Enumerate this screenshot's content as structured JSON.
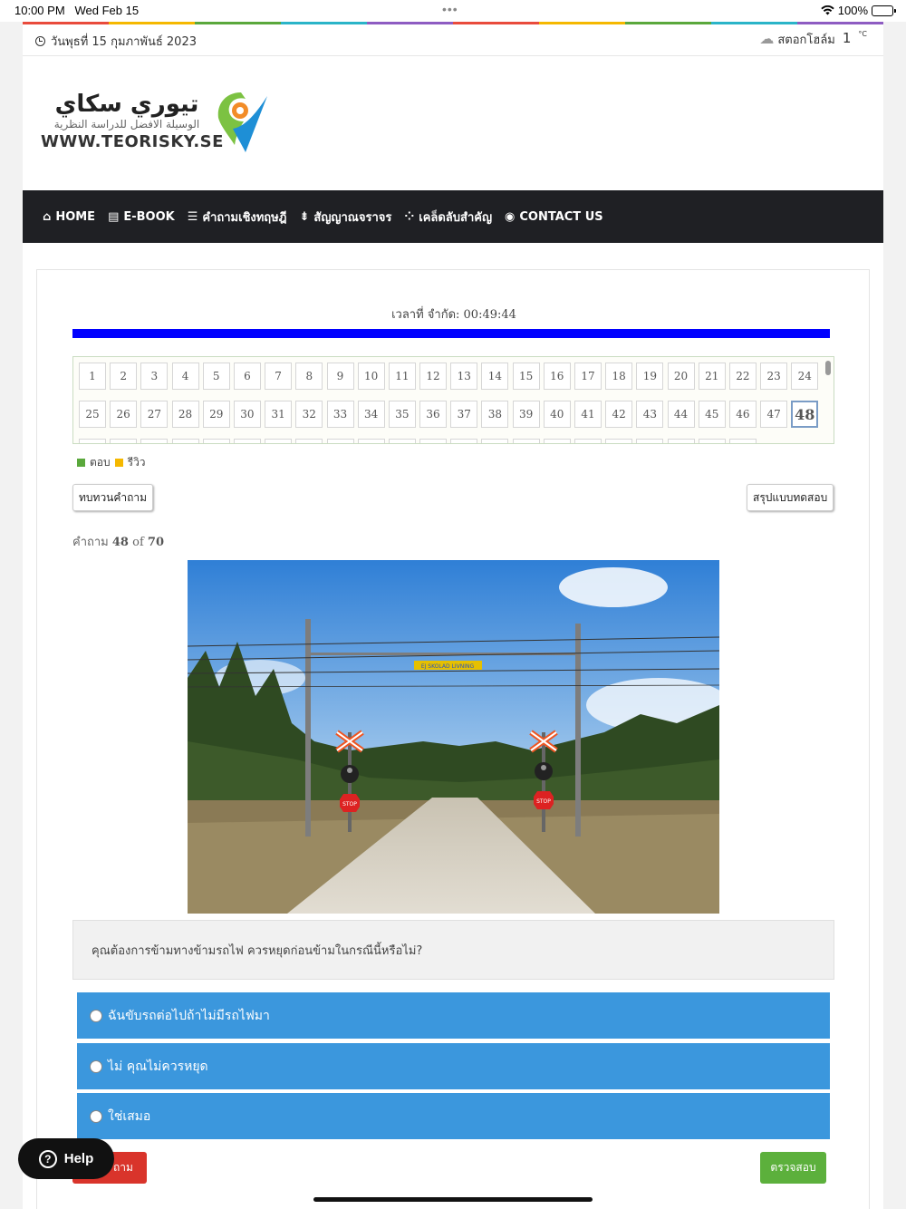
{
  "status_bar": {
    "time": "10:00 PM",
    "date": "Wed Feb 15",
    "battery": "100%"
  },
  "topbar": {
    "date": "วันพุธที่ 15 กุมภาพันธ์ 2023",
    "city": "สตอกโฮล์ม",
    "temp": "1",
    "unit": "°C"
  },
  "logo": {
    "arabic_title": "تيوري سكاي",
    "arabic_subtitle": "الوسيلة الافضل للدراسة النظرية",
    "url": "WWW.TEORISKY.SE"
  },
  "nav": {
    "items": [
      {
        "label": "HOME",
        "icon": "home-icon"
      },
      {
        "label": "E-BOOK",
        "icon": "book-icon"
      },
      {
        "label": "คำถามเชิงทฤษฎี",
        "icon": "list-icon"
      },
      {
        "label": "สัญญาณจราจร",
        "icon": "signpost-icon"
      },
      {
        "label": "เคล็ดลับสำคัญ",
        "icon": "tips-icon"
      },
      {
        "label": "CONTACT US",
        "icon": "messenger-icon"
      }
    ]
  },
  "quiz": {
    "timer": "เวลาที่ จำกัด: 00:49:44",
    "progress": 1.0,
    "current_question": 48,
    "legend_answered": "ตอบ",
    "legend_review": "รีวิว",
    "review_button": "ทบทวนคำถาม",
    "summary_button": "สรุปแบบทดสอบ",
    "counter_prefix": "คำถาม",
    "counter_current": "48",
    "counter_of": "of",
    "counter_total": "70",
    "question": "คุณต้องการข้ามทางข้ามรถไฟ ควรหยุดก่อนข้ามในกรณีนี้หรือไม่?",
    "answers": [
      "ฉันขับรถต่อไปถ้าไม่มีรถไฟมา",
      "ไม่ คุณไม่ควรหยุด",
      "ใช่เสมอ"
    ],
    "prev_button": "ถาม",
    "check_button": "ตรวจสอบ",
    "sign_text": "EJ SKOLAD LIVNING",
    "stop_text": "STOP"
  },
  "help": {
    "label": "Help"
  },
  "colors": {
    "nav_bg": "#1f2024",
    "progress": "#0000ff",
    "answer_bg": "#3b97dd",
    "answered": "#5aa83c",
    "review": "#f5b800",
    "danger": "#d9342b",
    "success": "#5cb03c"
  }
}
